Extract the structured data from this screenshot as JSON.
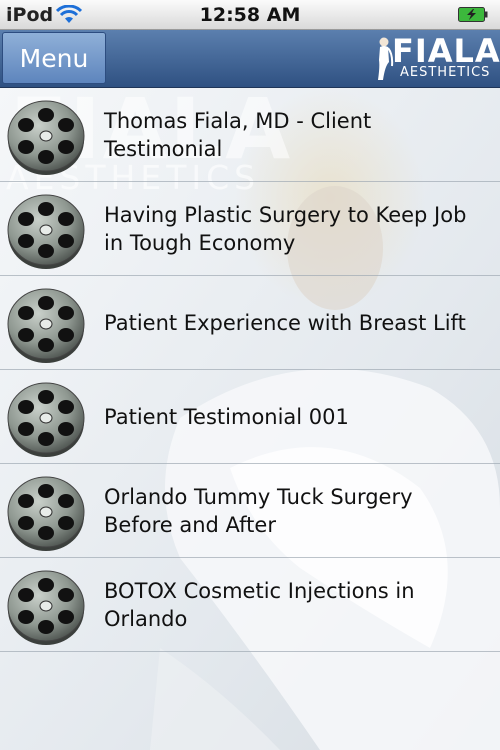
{
  "status_bar": {
    "carrier": "iPod",
    "time": "12:58 AM",
    "wifi_icon": "wifi-icon",
    "battery_icon": "battery-charging-icon"
  },
  "nav": {
    "menu_label": "Menu",
    "logo_title": "FIALA",
    "logo_subtitle": "AESTHETICS"
  },
  "background": {
    "watermark_title": "FIALA",
    "watermark_subtitle": "AESTHETICS"
  },
  "videos": [
    {
      "title": "Thomas Fiala, MD - Client Testimonial",
      "icon": "film-reel-icon"
    },
    {
      "title": "Having Plastic Surgery to Keep Job in Tough Economy",
      "icon": "film-reel-icon"
    },
    {
      "title": "Patient Experience with Breast Lift",
      "icon": "film-reel-icon"
    },
    {
      "title": "Patient Testimonial 001",
      "icon": "film-reel-icon"
    },
    {
      "title": "Orlando Tummy Tuck Surgery Before and After",
      "icon": "film-reel-icon"
    },
    {
      "title": "BOTOX Cosmetic Injections in Orlando",
      "icon": "film-reel-icon"
    }
  ],
  "colors": {
    "navbar": "#3e6293",
    "menu_button": "#7196c8",
    "status_bar": "#e6e6e6"
  }
}
